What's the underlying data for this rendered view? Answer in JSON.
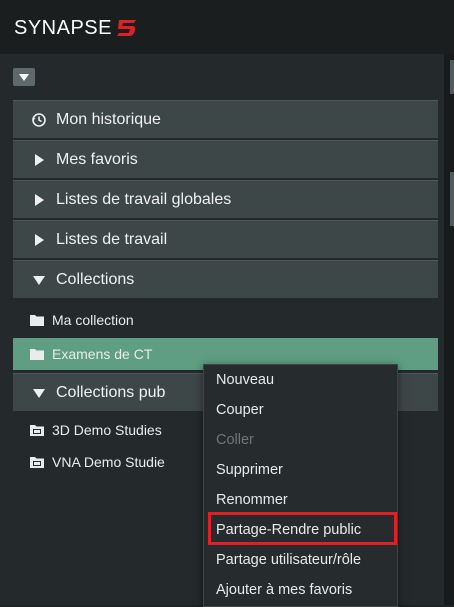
{
  "app": {
    "logo_text": "SYNAPSE",
    "logo_mark": "5",
    "accent_color": "#e01f26"
  },
  "sidebar": {
    "collapse_icon": "triangle-down-icon",
    "sections": [
      {
        "label": "Mon historique",
        "icon": "history-icon"
      },
      {
        "label": "Mes favoris",
        "icon": "triangle-right-icon"
      },
      {
        "label": "Listes de travail globales",
        "icon": "triangle-right-icon"
      },
      {
        "label": "Listes de travail",
        "icon": "triangle-right-icon"
      },
      {
        "label": "Collections",
        "icon": "triangle-down-icon"
      }
    ],
    "collections": [
      {
        "label": "Ma collection",
        "icon": "folder-icon"
      },
      {
        "label": "Examens de CT",
        "icon": "folder-icon",
        "selected": true
      }
    ],
    "public_section": {
      "label": "Collections pub",
      "icon": "triangle-down-icon"
    },
    "public_collections": [
      {
        "label": "3D Demo Studies",
        "icon": "shared-folder-icon"
      },
      {
        "label": "VNA Demo Studie",
        "icon": "shared-folder-icon"
      }
    ],
    "selected_color": "#5f9e83"
  },
  "context_menu": {
    "items": [
      {
        "label": "Nouveau",
        "enabled": true
      },
      {
        "label": "Couper",
        "enabled": true
      },
      {
        "label": "Coller",
        "enabled": false
      },
      {
        "label": "Supprimer",
        "enabled": true
      },
      {
        "label": "Renommer",
        "enabled": true
      },
      {
        "label": "Partage-Rendre public",
        "enabled": true,
        "highlighted": true
      },
      {
        "label": "Partage utilisateur/rôle",
        "enabled": true
      },
      {
        "label": "Ajouter à mes favoris",
        "enabled": true
      }
    ],
    "highlight_color": "#e01f26"
  }
}
